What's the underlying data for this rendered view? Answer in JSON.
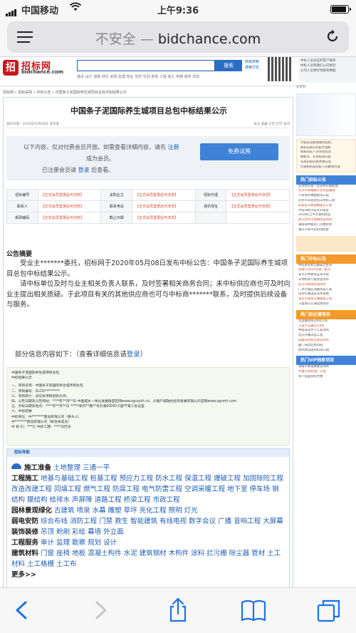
{
  "status": {
    "carrier": "中国移动",
    "time": "上午9:36"
  },
  "browser": {
    "not_secure": "不安全 —",
    "domain": "bidchance.com"
  },
  "site": {
    "brand": "招标网",
    "domain": "bidchance.com",
    "search_button": "搜索",
    "adv_search": [
      "高级搜索",
      "搜索历史"
    ],
    "hotwords": "建设  设计  道路  绿化  采购  监理  物业  安防  空调  景观  工程  施工  电梯  装修  改造",
    "right_top": [
      "中标人员对应的客户联系",
      "中标人员和我们公司更近",
      "公司人员更好地联系数据"
    ],
    "breadcrumb": "招标网 » 招标采购 » 中标公告 » 中国条子泥国际养生城项目总包中标结果公示"
  },
  "page": {
    "title": "中国条子泥国际养生城项目总包中标结果公示",
    "meta_left": "发布日期：2020年05月08日  发布者：",
    "meta_right": "关注  收藏  分享  打印  关闭",
    "login": {
      "line1": "以下内容，仅对付费会员开放。如需查看详细内容，请先",
      "register": "注册",
      "line2": "成为会员。",
      "line3a": "已注册会员请",
      "login_link": "登录",
      "line3b": "后查看。",
      "trial_button": "免费试用"
    },
    "info_rows": [
      [
        "招标编号",
        "【正式会员登录后可浏览】",
        "采购业主",
        "【正式会员登录后可浏览】",
        "招标代理",
        "【正式会员登录后可浏览】"
      ],
      [
        "联系人",
        "【正式会员登录后可浏览】",
        "联系电话",
        "【正式会员登录后可浏览】",
        "通讯地址",
        "【正式会员登录后可浏览】"
      ],
      [
        "邮政编码",
        "【正式会员登录后可浏览】",
        "截止日期",
        "【正式会员登录后可浏览】",
        "",
        ""
      ]
    ],
    "summary_heading": "公告摘要",
    "summary_p1": "受业主*******委托，招标网于2020年05月08日发布中标公告：中国条子泥国际养生城项目总包中标结果公示。",
    "summary_p2": "请中标单位及时与业主相关负责人联系，及时签署相关商务合同；未中标供应商也可及时向业主提出相关质疑。于此项目有关的其他供应商也可与中标商*******联系，及时提供后续设备与服务。",
    "part_text": "部分信息内容如下：（查看详细信息请",
    "part_login": "登录",
    "part_end": "）",
    "doc_lines": [
      "中国条子泥国际养生城项目总包",
      "中标结果公示",
      "一、项目名称：中国条子泥国际养生城项目总包",
      "二、项目编号：ZLCG*********",
      "三、项目简介：详见本项目招标文件。",
      "四、公告日期及公告网站：****年**月**日  中国城乡一体化发展联盟官网www.zgcxyth.cn、众联产城融合投资发展有限公司官网www.zgcorh.com",
      "五、开标日期及地点：****年**月**日  *****新开**路**号外滩SOHO-C座*F第三会议室",
      "六、中标结果",
      "中标单位：中*******建设有限公司（牵头人）",
      "中*******建设有限公司（联合体成员）",
      "中 标 价：***亿  中标工期：****日历天"
    ],
    "nav": {
      "header": "招标导航",
      "cats": [
        {
          "name": "施工准备",
          "items": "土地整理 三通一平"
        },
        {
          "name": "工程施工",
          "items": "地基与基础工程 桩基工程 预应力工程 防水工程 保温工程 爆破工程 加固除险工程 改造改建工程 回填工程 燃气工程 防腐工程 电气防雷工程 空调采暖工程 地下室 停车场 钢结构 膜结构 给排水 声屏障 道路工程 桥梁工程 市政工程"
        },
        {
          "name": "园林景观绿化",
          "items": "古建筑 喷泉 水幕 雕塑 草坪 亮化工程 照明 灯光"
        },
        {
          "name": "弱电安防",
          "items": "综合布线 消防工程 门禁 救生 智能建筑 有线电视 数字会议 广播 音响工程 大屏幕"
        },
        {
          "name": "装饰装修",
          "items": "吊顶 粉刷 彩绘 幕墙 外立面"
        },
        {
          "name": "工程服务",
          "items": "审计 监理 勘察 规划 设计"
        },
        {
          "name": "建筑材料",
          "items": "门窗 座椅 地板 混凝土构件 水泥 建筑钢材 木构件 涂料 拦污栅 除尘器 管材 土工材料 土工格栅 土工布"
        }
      ],
      "more": "更多>>"
    }
  },
  "sidebar": {
    "share": "分享到：",
    "promo_lines": [
      "为保证您能够顺利投标，",
      "报标前请与招标代理机",
      "构和招标人咨询投标详",
      "细要求，有关投标的具",
      "有关招标的具体事宜及",
      "代理机构或招标人的解释为准"
    ],
    "hot_bid": {
      "title": "热门招标公告",
      "items": [
        "石河村市第一连农村公厕新建",
        "云浮市新福都小型农田灌溉",
        "千米商务楼群配电工程",
        "苏州市公园改造与绿化工程",
        "同安区市政道路提升工程",
        "大蒜湾经济技术开发区",
        "2018年上半年管网改造",
        "关于台州市电网改造项目",
        "湖南省中医院门诊楼装修",
        "重庆市梁平区机场配套"
      ]
    },
    "hot_win": {
      "title": "热门中标公告",
      "items": [
        "中标县农村公路安全生命",
        "高速市2014年第一批次",
        "长沙市中建第五局市政",
        "公共机构节能改造项目",
        "武汉市桥梁检测项目",
        "广州市城区道路改造工程",
        "深圳市福田区排水管网",
        "南京市轨道交通配套工程",
        "宁夏银川交通运维项目"
      ]
    },
    "hot_proj": {
      "title": "热门拟在建项目",
      "items": [
        "年运输总吨2000万吨",
        "宁波市交通2019年",
        "中国海洋大学工程项目",
        "北京环路改造工程",
        "成都天府新区建设项目",
        "厦门海沧区物流园",
        "杭州萧山国际机场三期"
      ]
    },
    "hot_vip": {
      "title": "热门VIP独家项目",
      "items": [
        "县城市政道路建设项目",
        "乡镇污水处理厂工程",
        "县人民医院综合楼"
      ]
    }
  }
}
